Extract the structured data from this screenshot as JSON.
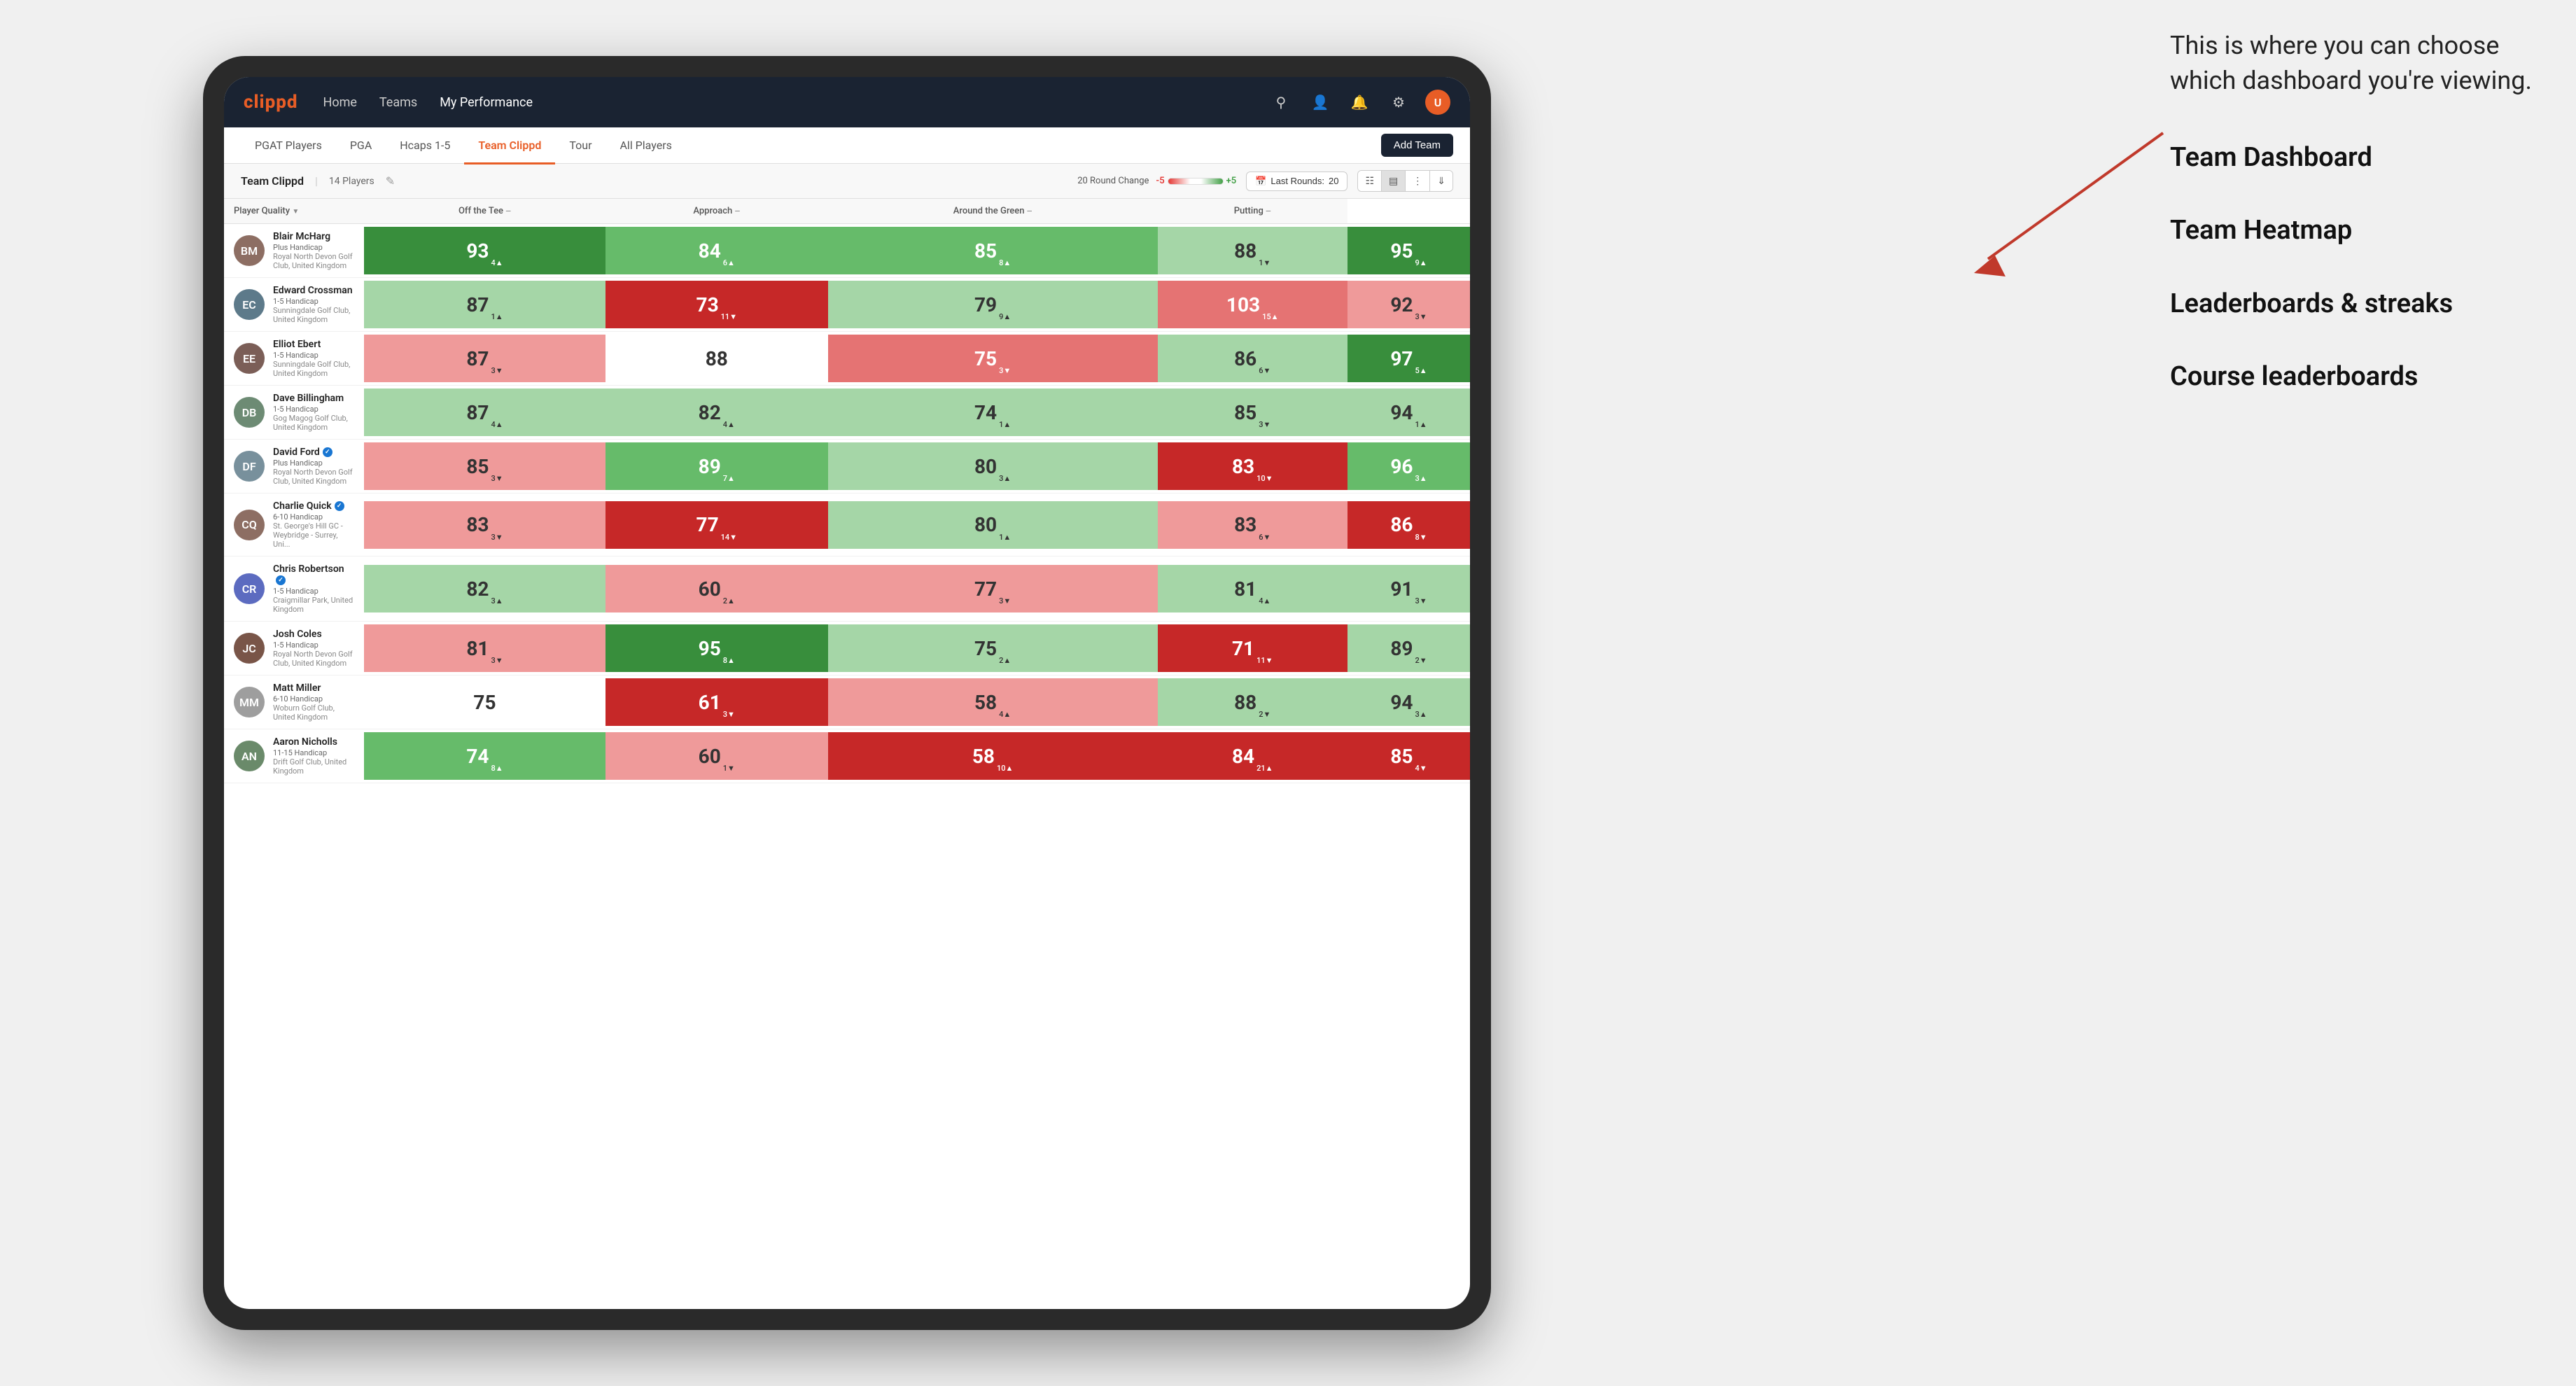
{
  "annotation": {
    "intro": "This is where you can choose which dashboard you're viewing.",
    "items": [
      "Team Dashboard",
      "Team Heatmap",
      "Leaderboards & streaks",
      "Course leaderboards"
    ]
  },
  "navbar": {
    "logo": "clippd",
    "links": [
      "Home",
      "Teams",
      "My Performance"
    ],
    "active_link": "My Performance"
  },
  "tabs": {
    "items": [
      "PGAT Players",
      "PGA",
      "Hcaps 1-5",
      "Team Clippd",
      "Tour",
      "All Players"
    ],
    "active": "Team Clippd",
    "add_button": "Add Team"
  },
  "team_header": {
    "name": "Team Clippd",
    "separator": "|",
    "count": "14 Players",
    "round_change_label": "20 Round Change",
    "scale_min": "-5",
    "scale_max": "+5",
    "last_rounds_label": "Last Rounds:",
    "last_rounds_value": "20"
  },
  "columns": [
    {
      "label": "Player Quality",
      "sort": "▼"
    },
    {
      "label": "Off the Tee",
      "sort": "—"
    },
    {
      "label": "Approach",
      "sort": "—"
    },
    {
      "label": "Around the Green",
      "sort": "—"
    },
    {
      "label": "Putting",
      "sort": "—"
    }
  ],
  "players": [
    {
      "name": "Blair McHarg",
      "handicap": "Plus Handicap",
      "club": "Royal North Devon Golf Club, United Kingdom",
      "avatar_color": "#8d6e63",
      "avatar_initials": "BM",
      "scores": [
        {
          "value": 93,
          "change": 4,
          "dir": "up",
          "bg": "bg-green-dark"
        },
        {
          "value": 84,
          "change": 6,
          "dir": "up",
          "bg": "bg-green-med"
        },
        {
          "value": 85,
          "change": 8,
          "dir": "up",
          "bg": "bg-green-med"
        },
        {
          "value": 88,
          "change": 1,
          "dir": "down",
          "bg": "bg-green-light"
        },
        {
          "value": 95,
          "change": 9,
          "dir": "up",
          "bg": "bg-green-dark"
        }
      ]
    },
    {
      "name": "Edward Crossman",
      "handicap": "1-5 Handicap",
      "club": "Sunningdale Golf Club, United Kingdom",
      "avatar_color": "#5d7a8a",
      "avatar_initials": "EC",
      "scores": [
        {
          "value": 87,
          "change": 1,
          "dir": "up",
          "bg": "bg-green-light"
        },
        {
          "value": 73,
          "change": 11,
          "dir": "down",
          "bg": "bg-red-dark"
        },
        {
          "value": 79,
          "change": 9,
          "dir": "up",
          "bg": "bg-green-light"
        },
        {
          "value": 103,
          "change": 15,
          "dir": "up",
          "bg": "bg-red-med"
        },
        {
          "value": 92,
          "change": 3,
          "dir": "down",
          "bg": "bg-red-light"
        }
      ]
    },
    {
      "name": "Elliot Ebert",
      "handicap": "1-5 Handicap",
      "club": "Sunningdale Golf Club, United Kingdom",
      "avatar_color": "#7b5e57",
      "avatar_initials": "EE",
      "scores": [
        {
          "value": 87,
          "change": 3,
          "dir": "down",
          "bg": "bg-red-light"
        },
        {
          "value": 88,
          "change": null,
          "dir": null,
          "bg": "bg-white"
        },
        {
          "value": 75,
          "change": 3,
          "dir": "down",
          "bg": "bg-red-med"
        },
        {
          "value": 86,
          "change": 6,
          "dir": "down",
          "bg": "bg-green-light"
        },
        {
          "value": 97,
          "change": 5,
          "dir": "up",
          "bg": "bg-green-dark"
        }
      ]
    },
    {
      "name": "Dave Billingham",
      "handicap": "1-5 Handicap",
      "club": "Gog Magog Golf Club, United Kingdom",
      "avatar_color": "#6d8b74",
      "avatar_initials": "DB",
      "scores": [
        {
          "value": 87,
          "change": 4,
          "dir": "up",
          "bg": "bg-green-light"
        },
        {
          "value": 82,
          "change": 4,
          "dir": "up",
          "bg": "bg-green-light"
        },
        {
          "value": 74,
          "change": 1,
          "dir": "up",
          "bg": "bg-green-light"
        },
        {
          "value": 85,
          "change": 3,
          "dir": "down",
          "bg": "bg-green-light"
        },
        {
          "value": 94,
          "change": 1,
          "dir": "up",
          "bg": "bg-green-light"
        }
      ]
    },
    {
      "name": "David Ford",
      "handicap": "Plus Handicap",
      "club": "Royal North Devon Golf Club, United Kingdom",
      "avatar_color": "#78909c",
      "avatar_initials": "DF",
      "verified": true,
      "scores": [
        {
          "value": 85,
          "change": 3,
          "dir": "down",
          "bg": "bg-red-light"
        },
        {
          "value": 89,
          "change": 7,
          "dir": "up",
          "bg": "bg-green-med"
        },
        {
          "value": 80,
          "change": 3,
          "dir": "up",
          "bg": "bg-green-light"
        },
        {
          "value": 83,
          "change": 10,
          "dir": "down",
          "bg": "bg-red-dark"
        },
        {
          "value": 96,
          "change": 3,
          "dir": "up",
          "bg": "bg-green-med"
        }
      ]
    },
    {
      "name": "Charlie Quick",
      "handicap": "6-10 Handicap",
      "club": "St. George's Hill GC - Weybridge - Surrey, Uni...",
      "avatar_color": "#8d6e63",
      "avatar_initials": "CQ",
      "verified": true,
      "scores": [
        {
          "value": 83,
          "change": 3,
          "dir": "down",
          "bg": "bg-red-light"
        },
        {
          "value": 77,
          "change": 14,
          "dir": "down",
          "bg": "bg-red-dark"
        },
        {
          "value": 80,
          "change": 1,
          "dir": "up",
          "bg": "bg-green-light"
        },
        {
          "value": 83,
          "change": 6,
          "dir": "down",
          "bg": "bg-red-light"
        },
        {
          "value": 86,
          "change": 8,
          "dir": "down",
          "bg": "bg-red-dark"
        }
      ]
    },
    {
      "name": "Chris Robertson",
      "handicap": "1-5 Handicap",
      "club": "Craigmillar Park, United Kingdom",
      "avatar_color": "#5c6bc0",
      "avatar_initials": "CR",
      "verified": true,
      "scores": [
        {
          "value": 82,
          "change": 3,
          "dir": "up",
          "bg": "bg-green-light"
        },
        {
          "value": 60,
          "change": 2,
          "dir": "up",
          "bg": "bg-red-light"
        },
        {
          "value": 77,
          "change": 3,
          "dir": "down",
          "bg": "bg-red-light"
        },
        {
          "value": 81,
          "change": 4,
          "dir": "up",
          "bg": "bg-green-light"
        },
        {
          "value": 91,
          "change": 3,
          "dir": "down",
          "bg": "bg-green-light"
        }
      ]
    },
    {
      "name": "Josh Coles",
      "handicap": "1-5 Handicap",
      "club": "Royal North Devon Golf Club, United Kingdom",
      "avatar_color": "#795548",
      "avatar_initials": "JC",
      "scores": [
        {
          "value": 81,
          "change": 3,
          "dir": "down",
          "bg": "bg-red-light"
        },
        {
          "value": 95,
          "change": 8,
          "dir": "up",
          "bg": "bg-green-dark"
        },
        {
          "value": 75,
          "change": 2,
          "dir": "up",
          "bg": "bg-green-light"
        },
        {
          "value": 71,
          "change": 11,
          "dir": "down",
          "bg": "bg-red-dark"
        },
        {
          "value": 89,
          "change": 2,
          "dir": "down",
          "bg": "bg-green-light"
        }
      ]
    },
    {
      "name": "Matt Miller",
      "handicap": "6-10 Handicap",
      "club": "Woburn Golf Club, United Kingdom",
      "avatar_color": "#9e9e9e",
      "avatar_initials": "MM",
      "scores": [
        {
          "value": 75,
          "change": null,
          "dir": null,
          "bg": "bg-white"
        },
        {
          "value": 61,
          "change": 3,
          "dir": "down",
          "bg": "bg-red-dark"
        },
        {
          "value": 58,
          "change": 4,
          "dir": "up",
          "bg": "bg-red-light"
        },
        {
          "value": 88,
          "change": 2,
          "dir": "down",
          "bg": "bg-green-light"
        },
        {
          "value": 94,
          "change": 3,
          "dir": "up",
          "bg": "bg-green-light"
        }
      ]
    },
    {
      "name": "Aaron Nicholls",
      "handicap": "11-15 Handicap",
      "club": "Drift Golf Club, United Kingdom",
      "avatar_color": "#6a8a6a",
      "avatar_initials": "AN",
      "scores": [
        {
          "value": 74,
          "change": 8,
          "dir": "up",
          "bg": "bg-green-med"
        },
        {
          "value": 60,
          "change": 1,
          "dir": "down",
          "bg": "bg-red-light"
        },
        {
          "value": 58,
          "change": 10,
          "dir": "up",
          "bg": "bg-red-dark"
        },
        {
          "value": 84,
          "change": 21,
          "dir": "up",
          "bg": "bg-red-dark"
        },
        {
          "value": 85,
          "change": 4,
          "dir": "down",
          "bg": "bg-red-dark"
        }
      ]
    }
  ]
}
